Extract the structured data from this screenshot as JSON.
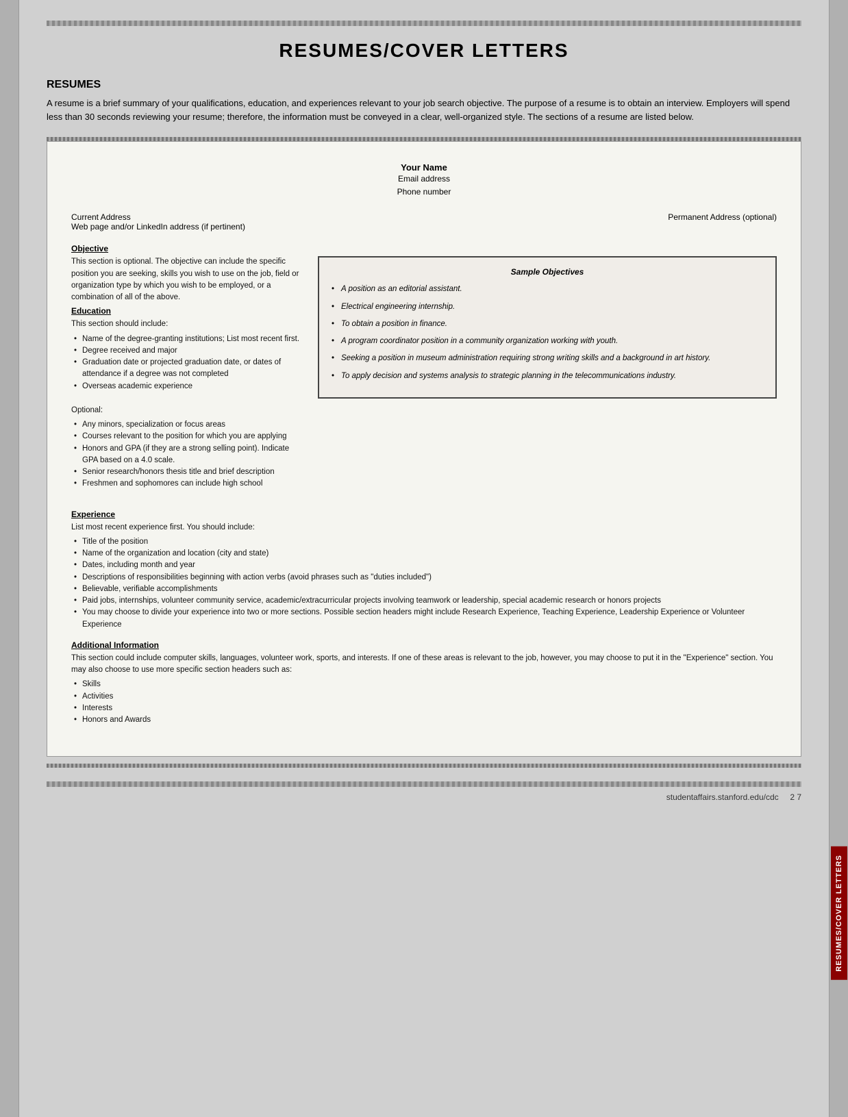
{
  "page": {
    "title": "RESUMES/COVER LETTERS",
    "footer_url": "studentaffairs.stanford.edu/cdc",
    "footer_page": "2 7"
  },
  "resumes_section": {
    "heading": "RESUMES",
    "intro": "A resume is a brief summary of your qualifications, education, and experiences relevant to your job search objective. The purpose of a resume is to obtain an interview. Employers will spend less than 30 seconds reviewing your resume; therefore, the information must be conveyed in a clear, well-organized style. The sections of a resume are listed below."
  },
  "resume_template": {
    "name": "Your Name",
    "email": "Email address",
    "phone": "Phone number",
    "current_address_label": "Current Address",
    "web_label": "Web page and/or LinkedIn address (if pertinent)",
    "permanent_address_label": "Permanent Address (optional)",
    "objective_heading": "Objective",
    "objective_text": "This section is optional. The objective can include the specific position you are seeking, skills you wish to use on the job, field or organization type by which you wish to be employed, or a combination of all of the above.",
    "education_heading": "Education",
    "education_intro": "This section should include:",
    "education_bullets": [
      "Name of the degree-granting institutions; List most recent first.",
      "Degree received and major",
      "Graduation date or projected graduation date, or dates of attendance if a degree was not completed",
      "Overseas academic experience"
    ],
    "education_optional_label": "Optional:",
    "education_optional_bullets": [
      "Any minors, specialization or focus areas",
      "Courses relevant to the position for which you are applying",
      "Honors and GPA (if they are a strong selling point). Indicate GPA based on a 4.0 scale.",
      "Senior research/honors thesis title and brief description",
      "Freshmen and sophomores can include high school"
    ],
    "experience_heading": "Experience",
    "experience_intro": "List most recent experience first. You should include:",
    "experience_bullets": [
      "Title of the position",
      "Name of the organization and location (city and state)",
      "Dates, including month and year",
      "Descriptions of responsibilities beginning with action verbs (avoid phrases such as \"duties included\")",
      "Believable, verifiable accomplishments",
      "Paid jobs, internships, volunteer community service, academic/extracurricular projects involving teamwork or leadership, special academic research or honors projects",
      "You may choose to divide your experience into two or more sections. Possible section headers might include Research Experience, Teaching Experience, Leadership Experience or Volunteer Experience"
    ],
    "additional_info_heading": "Additional Information",
    "additional_info_text": "This section could include computer skills, languages, volunteer work, sports, and interests. If one of these areas is relevant to the job, however, you may choose to put it in the \"Experience\" section. You may also choose to use more specific section headers such as:",
    "additional_info_bullets": [
      "Skills",
      "Activities",
      "Interests",
      "Honors and Awards"
    ]
  },
  "sample_objectives": {
    "title": "Sample Objectives",
    "items": [
      "A position as an editorial assistant.",
      "Electrical engineering internship.",
      "To obtain a position in finance.",
      "A program coordinator position in a community organization working with youth.",
      "Seeking a position in museum administration requiring strong writing skills and a background in art history.",
      "To apply decision and systems analysis to strategic planning in the telecommunications industry."
    ]
  },
  "side_tab": {
    "text": "RESUMES/COVER LETTERS"
  }
}
